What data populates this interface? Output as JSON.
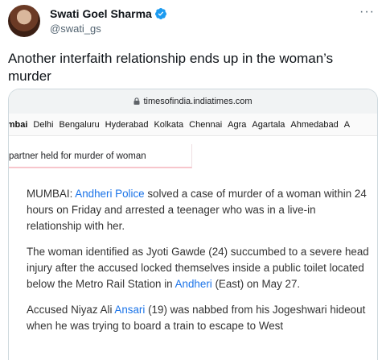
{
  "tweet": {
    "display_name": "Swati Goel Sharma",
    "handle": "@swati_gs",
    "text": "Another interfaith relationship ends up in the woman’s murder",
    "more_icon": "ellipsis-icon",
    "verified_icon": "verified-badge-icon"
  },
  "browser": {
    "url": "timesofindia.indiatimes.com"
  },
  "nav": {
    "items": [
      "umbai",
      "Delhi",
      "Bengaluru",
      "Hyderabad",
      "Kolkata",
      "Chennai",
      "Agra",
      "Agartala",
      "Ahmedabad",
      "A"
    ]
  },
  "headline": {
    "text": "partner held for murder of woman"
  },
  "article": {
    "p1_a": "MUMBAI: ",
    "p1_link": "Andheri Police",
    "p1_b": " solved a case of murder of a woman within 24 hours on Friday and arrested a teenager who was in a live-in relationship with her.",
    "p2_a": "The woman identified as Jyoti Gawde (24) succumbed to a severe head injury after the accused locked themselves inside a public toilet located below the Metro Rail Station in ",
    "p2_link": "Andheri",
    "p2_b": " (East) on May 27.",
    "p3_a": "Accused Niyaz Ali ",
    "p3_link": "Ansari",
    "p3_b": " (19) was nabbed from his Jogeshwari hideout when he was trying to board a train to escape to West"
  },
  "colors": {
    "link": "#1a73e8",
    "verified": "#1d9bf0",
    "alert_underline": "#f7c6cc"
  }
}
